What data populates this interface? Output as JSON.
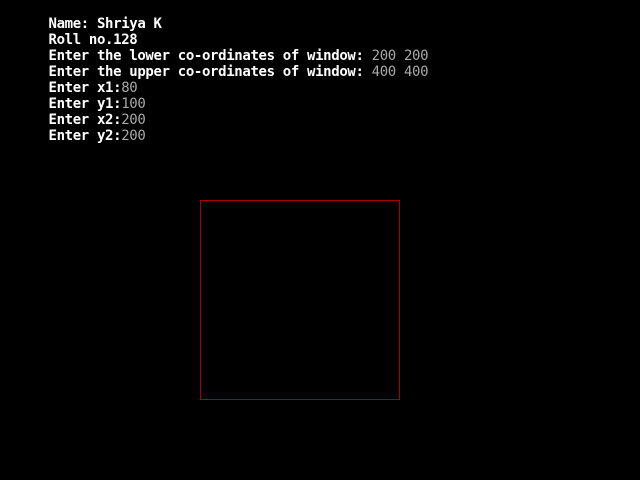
{
  "header": {
    "name_line": "Name: Shriya K",
    "roll_line": "Roll no.128"
  },
  "prompts": {
    "lower_window": {
      "label": "Enter the lower co-ordinates of window: ",
      "value": "200 200"
    },
    "upper_window": {
      "label": "Enter the upper co-ordinates of window: ",
      "value": "400 400"
    },
    "x1": {
      "label": "Enter x1:",
      "value": "80"
    },
    "y1": {
      "label": "Enter y1:",
      "value": "100"
    },
    "x2": {
      "label": "Enter x2:",
      "value": "200"
    },
    "y2": {
      "label": "Enter y2:",
      "value": "200"
    }
  },
  "colors": {
    "background": "#000000",
    "prompt_text": "#ffffff",
    "input_text": "#a8a8a8",
    "window_border": "#a80000"
  }
}
